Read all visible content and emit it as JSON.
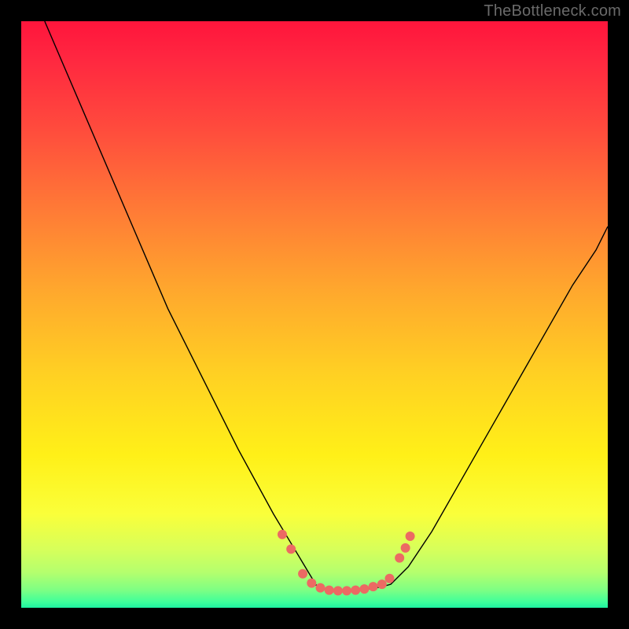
{
  "watermark": "TheBottleneck.com",
  "chart_data": {
    "type": "line",
    "title": "",
    "xlabel": "",
    "ylabel": "",
    "xlim": [
      0,
      100
    ],
    "ylim": [
      0,
      100
    ],
    "grid": false,
    "series": [
      {
        "name": "left-curve",
        "x": [
          4,
          7,
          10,
          13,
          16,
          19,
          22,
          25,
          28,
          31,
          34,
          37,
          40,
          43,
          46,
          49,
          50.5
        ],
        "values": [
          100,
          93,
          86,
          79,
          72,
          65,
          58,
          51,
          45,
          39,
          33,
          27,
          21.5,
          16,
          11,
          6,
          3.5
        ]
      },
      {
        "name": "floor",
        "x": [
          50.5,
          52,
          54,
          56,
          58,
          60,
          61.5,
          63
        ],
        "values": [
          3.5,
          3.2,
          3.0,
          3.0,
          3.1,
          3.3,
          3.6,
          4.0
        ]
      },
      {
        "name": "right-curve",
        "x": [
          63,
          66,
          70,
          74,
          78,
          82,
          86,
          90,
          94,
          98,
          100
        ],
        "values": [
          4.0,
          7,
          13,
          20,
          27,
          34,
          41,
          48,
          55,
          61,
          65
        ]
      }
    ],
    "markers": {
      "name": "bottom-dots",
      "points": [
        {
          "x": 44.5,
          "y": 12.5
        },
        {
          "x": 46.0,
          "y": 10.0
        },
        {
          "x": 48.0,
          "y": 5.8
        },
        {
          "x": 49.5,
          "y": 4.2
        },
        {
          "x": 51.0,
          "y": 3.4
        },
        {
          "x": 52.5,
          "y": 3.0
        },
        {
          "x": 54.0,
          "y": 2.9
        },
        {
          "x": 55.5,
          "y": 2.9
        },
        {
          "x": 57.0,
          "y": 3.0
        },
        {
          "x": 58.5,
          "y": 3.2
        },
        {
          "x": 60.0,
          "y": 3.6
        },
        {
          "x": 61.5,
          "y": 4.0
        },
        {
          "x": 62.8,
          "y": 5.0
        },
        {
          "x": 64.5,
          "y": 8.5
        },
        {
          "x": 65.5,
          "y": 10.2
        },
        {
          "x": 66.3,
          "y": 12.2
        }
      ],
      "color": "#ec6a63",
      "radius": 6
    },
    "background_gradient": {
      "stops": [
        {
          "pos": 0.0,
          "color": "#ff153c"
        },
        {
          "pos": 0.18,
          "color": "#ff4a3d"
        },
        {
          "pos": 0.46,
          "color": "#ffa82d"
        },
        {
          "pos": 0.74,
          "color": "#fff018"
        },
        {
          "pos": 0.9,
          "color": "#d7ff5a"
        },
        {
          "pos": 1.0,
          "color": "#1ef2a0"
        }
      ]
    }
  }
}
